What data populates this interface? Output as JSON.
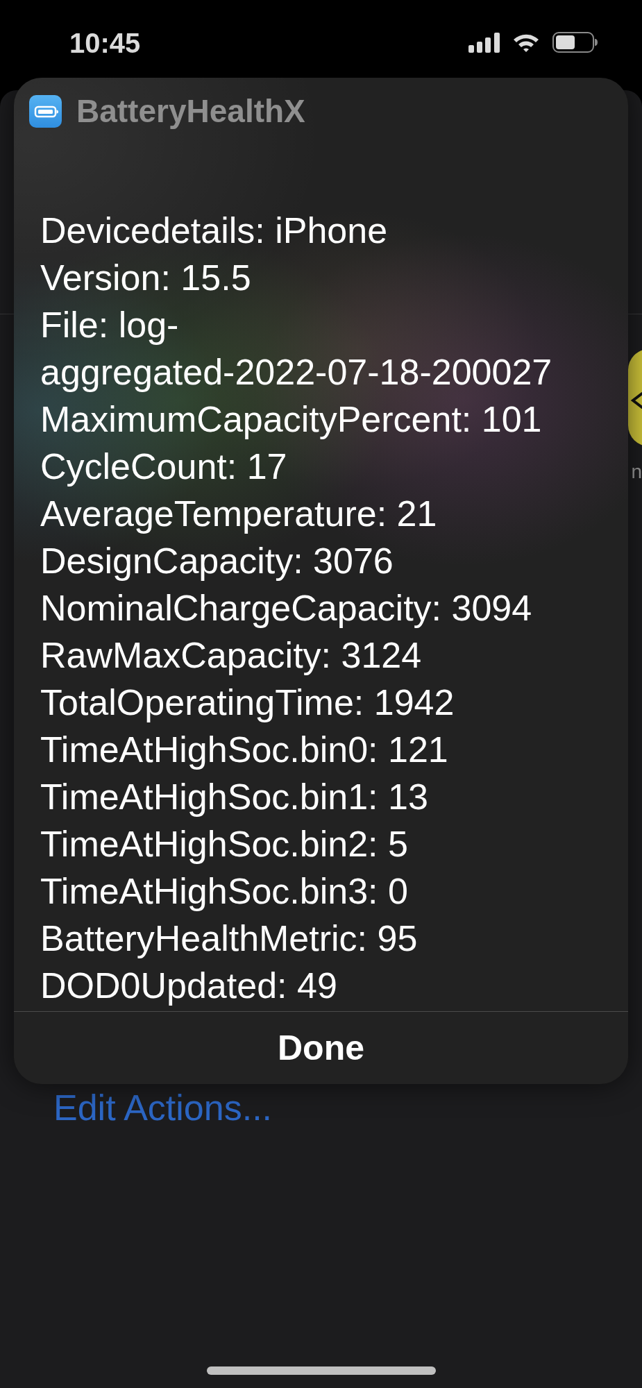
{
  "status_bar": {
    "time": "10:45"
  },
  "background": {
    "side_label": "n",
    "link": "Edit Actions..."
  },
  "dialog": {
    "app_name": "BatteryHealthX",
    "lines": [
      "Devicedetails: iPhone",
      "Version: 15.5",
      "File: log-",
      "aggregated-2022-07-18-200027",
      "MaximumCapacityPercent: 101",
      "CycleCount: 17",
      "AverageTemperature: 21",
      "DesignCapacity: 3076",
      "NominalChargeCapacity: 3094",
      "RawMaxCapacity: 3124",
      "TotalOperatingTime: 1942",
      "TimeAtHighSoc.bin0: 121",
      "TimeAtHighSoc.bin1: 13",
      "TimeAtHighSoc.bin2: 5",
      "TimeAtHighSoc.bin3: 0",
      "BatteryHealthMetric: 95",
      "DOD0Updated: 49"
    ],
    "button": "Done"
  }
}
